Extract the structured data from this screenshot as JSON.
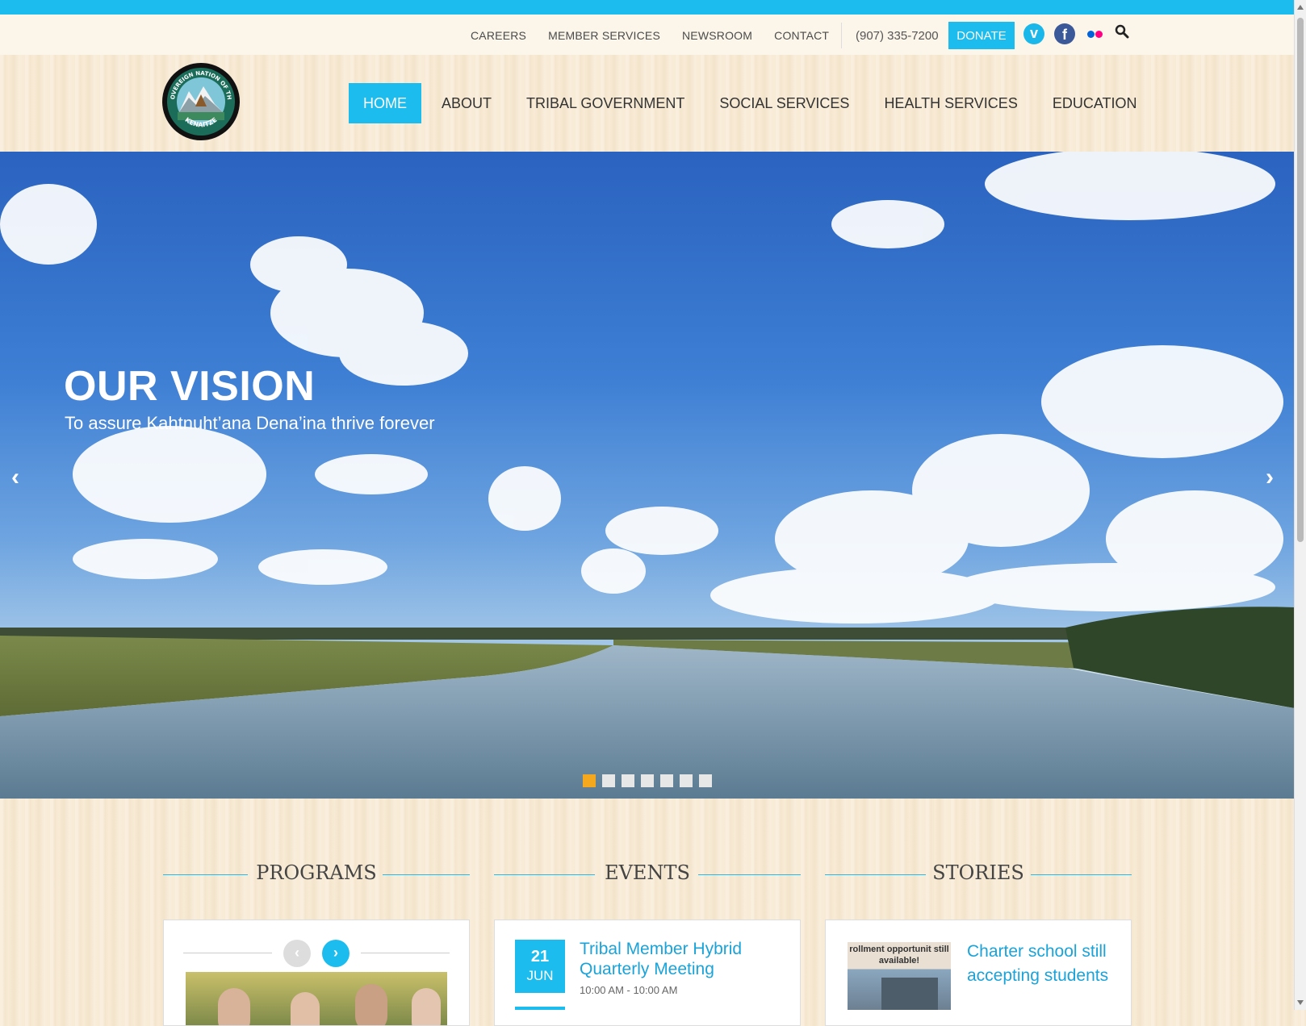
{
  "utility_nav": {
    "links": [
      "CAREERS",
      "MEMBER SERVICES",
      "NEWSROOM",
      "CONTACT"
    ],
    "phone": "(907) 335-7200",
    "donate": "DONATE",
    "social": [
      "vimeo-icon",
      "facebook-icon",
      "flickr-icon",
      "search-icon"
    ]
  },
  "logo": {
    "top_text": "SOVEREIGN NATION OF THE",
    "bottom_text": "KENAITZE"
  },
  "main_nav": {
    "items": [
      "HOME",
      "ABOUT",
      "TRIBAL GOVERNMENT",
      "SOCIAL SERVICES",
      "HEALTH SERVICES",
      "EDUCATION"
    ],
    "active": "HOME"
  },
  "hero": {
    "title": "OUR VISION",
    "subtitle": "To assure Kahtnuht’ana Dena’ina thrive forever",
    "slides_total": 7,
    "active_slide": 1
  },
  "sections": {
    "programs": "PROGRAMS",
    "events": "EVENTS",
    "stories": "STORIES"
  },
  "event": {
    "day": "21",
    "month": "JUN",
    "title": "Tribal Member Hybrid Quarterly Meeting",
    "time": "10:00 AM - 10:00 AM"
  },
  "story": {
    "title": "Charter school still accepting students",
    "thumb_text": "rollment opportunit still available!"
  },
  "colors": {
    "accent": "#1cbdee",
    "active_dot": "#f5a81e",
    "link": "#1aa3d9"
  }
}
